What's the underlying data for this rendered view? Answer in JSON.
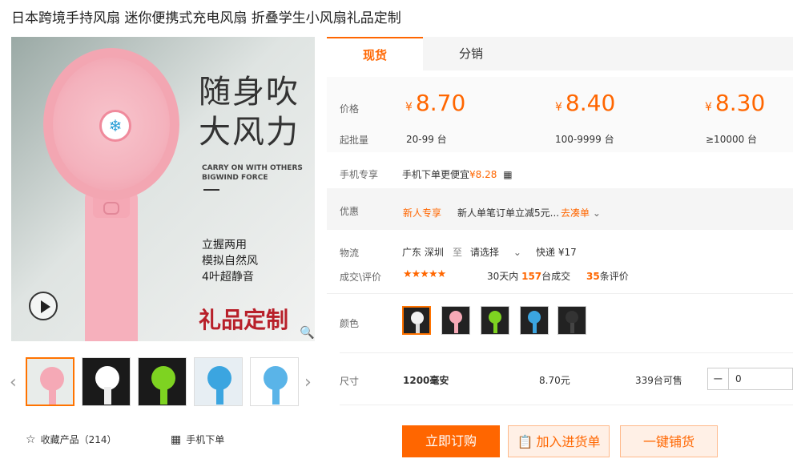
{
  "title": "日本跨境手持风扇 迷你便携式充电风扇 折叠学生小风扇礼品定制",
  "main_image": {
    "headline_1": "随身吹",
    "headline_2": "大风力",
    "en_line_1": "CARRY ON WITH OTHERS",
    "en_line_2": "BIGWIND FORCE",
    "feature_1": "立握两用",
    "feature_2": "模拟自然风",
    "feature_3": "4叶超静音",
    "gift": "礼品定制"
  },
  "thumbnails": [
    {
      "fan": "#f5a9b6",
      "handle": "#f5a9b6",
      "bg": "#e8ecea",
      "active": true
    },
    {
      "fan": "#ffffff",
      "handle": "#eeeeee",
      "bg": "#1a1a1a"
    },
    {
      "fan": "#7ed321",
      "handle": "#7ed321",
      "bg": "#1a1a1a"
    },
    {
      "fan": "#3ba5e0",
      "handle": "#3ba5e0",
      "bg": "#e7eef3"
    },
    {
      "fan": "#5ab4e8",
      "handle": "#5ab4e8",
      "bg": "#ffffff"
    }
  ],
  "favorite": {
    "icon": "star-outline-icon",
    "label": "收藏产品（214）"
  },
  "mobile_order": {
    "icon": "qrcode-icon",
    "label": "手机下单"
  },
  "tabs": [
    {
      "label": "现货"
    },
    {
      "label": "分销"
    }
  ],
  "price_label": "价格",
  "moq_label": "起批量",
  "currency": "¥",
  "tiers": [
    {
      "price": "8.70",
      "qty": "20-99 台"
    },
    {
      "price": "8.40",
      "qty": "100-9999 台"
    },
    {
      "price": "8.30",
      "qty": "≥10000 台"
    }
  ],
  "mobile_exclusive": {
    "label": "手机专享",
    "text": "手机下单更便宜",
    "price": "¥8.28"
  },
  "promo": {
    "label": "优惠",
    "tag": "新人专享",
    "text": "新人单笔订单立减5元...",
    "link": "去凑单"
  },
  "logistics": {
    "label": "物流",
    "from": "广东 深圳",
    "to_word": "至",
    "dest": "请选择",
    "express": "快递 ¥17"
  },
  "deals": {
    "label": "成交\\评价",
    "rating": "★★★★★",
    "period": "30天内",
    "count": "157",
    "unit": "台成交",
    "reviews": "35",
    "reviews_unit": "条评价"
  },
  "color_label": "颜色",
  "colors": [
    {
      "fan": "#f2f2f2",
      "handle": "#dddddd",
      "active": true
    },
    {
      "fan": "#f5a9b6",
      "handle": "#f5a9b6"
    },
    {
      "fan": "#7ed321",
      "handle": "#7ed321"
    },
    {
      "fan": "#3ba5e0",
      "handle": "#3ba5e0"
    },
    {
      "fan": "#333333",
      "handle": "#444444"
    }
  ],
  "size": {
    "label": "尺寸",
    "name": "1200毫安",
    "price": "8.70元",
    "stock": "339台可售",
    "quantity": "0"
  },
  "buttons": {
    "buy": "立即订购",
    "cart": "加入进货单",
    "ship": "一键铺货"
  }
}
